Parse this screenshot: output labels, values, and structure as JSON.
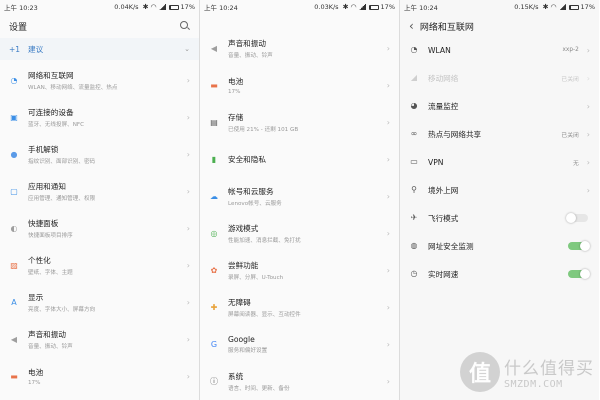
{
  "status_bars": [
    {
      "time": "上午 10:23",
      "net": "0.04K/s",
      "battery": "17%"
    },
    {
      "time": "上午 10:24",
      "net": "0.03K/s",
      "battery": "17%"
    },
    {
      "time": "上午 10:24",
      "net": "0.15K/s",
      "battery": "17%"
    }
  ],
  "panel1": {
    "title": "设置",
    "suggestion": {
      "plus": "+1",
      "label": "建议"
    },
    "items": [
      {
        "title": "网络和互联网",
        "subtitle": "WLAN、移动网络、流量监控、热点",
        "icon": "wifi-icon",
        "color": "#3a8ee6"
      },
      {
        "title": "可连接的设备",
        "subtitle": "蓝牙、无线投屏、NFC",
        "icon": "devices-icon",
        "color": "#3a8ee6"
      },
      {
        "title": "手机解锁",
        "subtitle": "指纹识别、面部识别、密码",
        "icon": "unlock-icon",
        "color": "#5b9be8"
      },
      {
        "title": "应用和通知",
        "subtitle": "应用管理、通知管理、权限",
        "icon": "apps-icon",
        "color": "#3a8ee6"
      },
      {
        "title": "快捷面板",
        "subtitle": "快捷面板项目排序",
        "icon": "toggle-icon",
        "color": "#9e9e9e"
      },
      {
        "title": "个性化",
        "subtitle": "壁纸、字体、主题",
        "icon": "wallpaper-icon",
        "color": "#e8734a"
      },
      {
        "title": "显示",
        "subtitle": "亮度、字体大小、屏幕方向",
        "icon": "display-icon",
        "color": "#3a8ee6"
      },
      {
        "title": "声音和振动",
        "subtitle": "音量、振动、铃声",
        "icon": "volume-icon",
        "color": "#9e9e9e"
      },
      {
        "title": "电池",
        "subtitle": "17%",
        "icon": "battery-icon",
        "color": "#e8734a"
      }
    ]
  },
  "panel2": {
    "items": [
      {
        "title": "声音和振动",
        "subtitle": "音量、振动、铃声",
        "icon": "volume-icon",
        "color": "#9e9e9e"
      },
      {
        "title": "电池",
        "subtitle": "17%",
        "icon": "battery-icon",
        "color": "#e8734a"
      },
      {
        "title": "存储",
        "subtitle": "已使用 21% - 还剩 101 GB",
        "icon": "storage-icon",
        "color": "#555555"
      },
      {
        "title": "安全和隐私",
        "subtitle": "",
        "icon": "lock-icon",
        "color": "#4caf50"
      },
      {
        "title": "帐号和云服务",
        "subtitle": "Lenovo帐号、云服务",
        "icon": "cloud-icon",
        "color": "#3a8ee6"
      },
      {
        "title": "游戏模式",
        "subtitle": "性能加速、消息拦截、免打扰",
        "icon": "gamepad-icon",
        "color": "#4caf50"
      },
      {
        "title": "尝鲜功能",
        "subtitle": "录屏、分屏、U-Touch",
        "icon": "flower-icon",
        "color": "#e8734a"
      },
      {
        "title": "无障碍",
        "subtitle": "屏幕阅读器、显示、互动控件",
        "icon": "accessibility-icon",
        "color": "#e8a23a"
      },
      {
        "title": "Google",
        "subtitle": "服务和偏好设置",
        "icon": "google-icon",
        "color": "#4285f4"
      },
      {
        "title": "系统",
        "subtitle": "语言、时间、更新、备份",
        "icon": "info-icon",
        "color": "#555555"
      }
    ]
  },
  "panel3": {
    "title": "网络和互联网",
    "items": [
      {
        "title": "WLAN",
        "value": "xxp-2",
        "icon": "wifi-icon",
        "control": "chevron",
        "disabled": false
      },
      {
        "title": "移动网络",
        "value": "已关闭",
        "icon": "signal-icon",
        "control": "chevron",
        "disabled": true
      },
      {
        "title": "流量监控",
        "value": "",
        "icon": "data-usage-icon",
        "control": "chevron",
        "disabled": false
      },
      {
        "title": "热点与网络共享",
        "value": "已关闭",
        "icon": "hotspot-icon",
        "control": "chevron",
        "disabled": false
      },
      {
        "title": "VPN",
        "value": "无",
        "icon": "vpn-icon",
        "control": "chevron",
        "disabled": false
      },
      {
        "title": "境外上网",
        "value": "",
        "icon": "globe-pin-icon",
        "control": "chevron",
        "disabled": false
      },
      {
        "title": "飞行模式",
        "value": "",
        "icon": "airplane-icon",
        "control": "toggle",
        "on": false,
        "disabled": false
      },
      {
        "title": "网址安全监测",
        "value": "",
        "icon": "globe-icon",
        "control": "toggle",
        "on": true,
        "disabled": false
      },
      {
        "title": "实时网速",
        "value": "",
        "icon": "speed-icon",
        "control": "toggle",
        "on": true,
        "disabled": false
      }
    ]
  },
  "watermark": {
    "line1": "什么值得买",
    "line2": "SMZDM.COM",
    "badge": "值"
  }
}
